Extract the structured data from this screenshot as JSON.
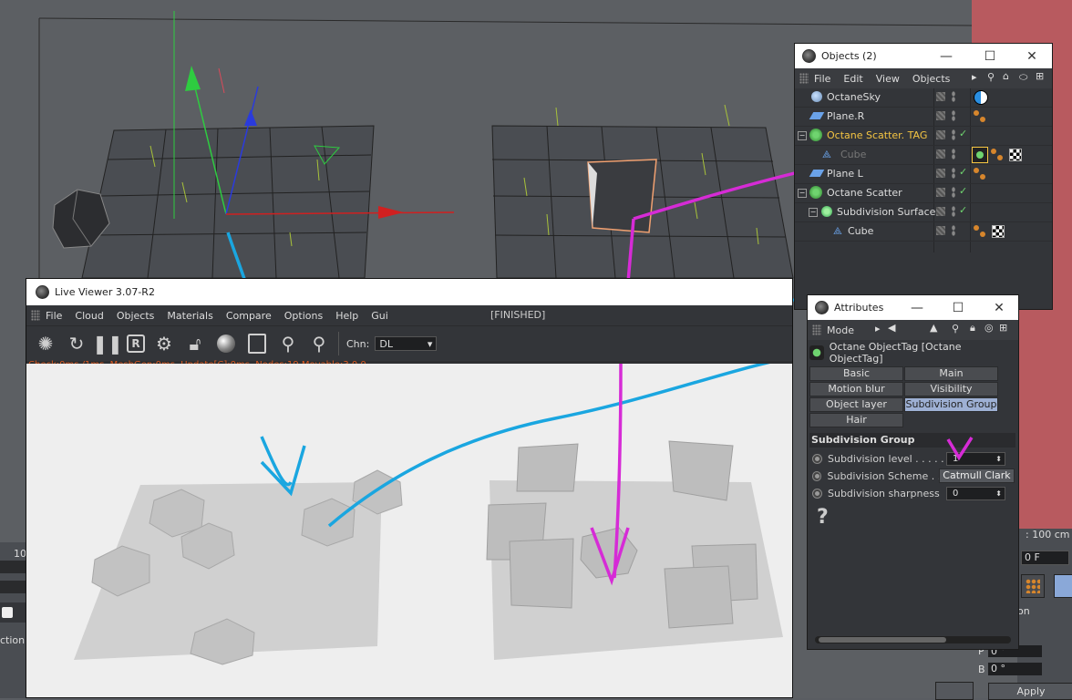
{
  "colors": {
    "annotation_magenta": "#d62bd6",
    "annotation_cyan": "#1aa6e0",
    "selection_highlight": "#f5c542",
    "tab_selected": "#9eb0d4"
  },
  "live_viewer": {
    "title": "Live Viewer 3.07-R2",
    "menu": [
      "File",
      "Cloud",
      "Objects",
      "Materials",
      "Compare",
      "Options",
      "Help",
      "Gui"
    ],
    "status": "[FINISHED]",
    "toolbar_icons": [
      "octane-logo-icon",
      "refresh-icon",
      "pause-icon",
      "region-render-icon",
      "settings-gear-icon",
      "lock-icon",
      "material-ball-icon",
      "focus-picker-icon",
      "f-pin-icon",
      "m-pin-icon"
    ],
    "region_label": "R",
    "chn_label": "Chn:",
    "chn_value": "DL",
    "stats": "Check:0ms./1ms. MeshGen:0ms. Update[C]:0ms. Nodes:19 Movable:3  0 0"
  },
  "objects_window": {
    "title": "Objects (2)",
    "menu": [
      "File",
      "Edit",
      "View",
      "Objects"
    ],
    "items": [
      {
        "name": "OctaneSky",
        "icon": "sky-sphere-icon"
      },
      {
        "name": "Plane.R",
        "icon": "plane-icon"
      },
      {
        "name": "Octane Scatter. TAG",
        "icon": "scatter-icon"
      },
      {
        "name": "Cube",
        "icon": "cube-icon"
      },
      {
        "name": "Plane L",
        "icon": "plane-icon"
      },
      {
        "name": "Octane Scatter",
        "icon": "scatter-icon"
      },
      {
        "name": "Subdivision Surface",
        "icon": "subdivision-icon"
      },
      {
        "name": "Cube",
        "icon": "cube-icon"
      }
    ]
  },
  "attributes_window": {
    "title": "Attributes",
    "mode_label": "Mode",
    "header": "Octane ObjectTag [Octane ObjectTag]",
    "tabs": [
      "Basic",
      "Main",
      "Motion blur",
      "Visibility",
      "Object layer",
      "Subdivision Group",
      "Hair"
    ],
    "active_tab": "Subdivision Group",
    "section_title": "Subdivision Group",
    "params": [
      {
        "label": "Subdivision level . . . . .",
        "value": "1"
      },
      {
        "label": "Subdivision Scheme . .",
        "value": "Catmull Clark"
      },
      {
        "label": "Subdivision sharpness",
        "value": "0"
      }
    ],
    "help_glyph": "?"
  },
  "background_panels": {
    "size_value": ": 100 cm",
    "frame_value": "0 F",
    "on_label": "on",
    "p_label": "P",
    "p_value": "0 °",
    "b_label": "B",
    "b_value": "0 °",
    "apply_label": "Apply",
    "left_number": "10",
    "left_label": "ction"
  }
}
